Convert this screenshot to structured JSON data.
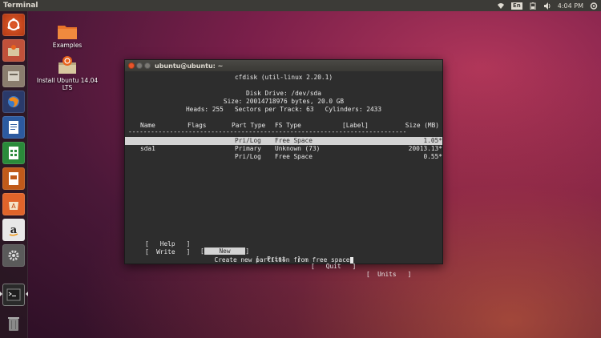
{
  "top_panel": {
    "title": "Terminal",
    "keyboard": "En",
    "time": "4:04 PM"
  },
  "desktop": {
    "icons": [
      {
        "label": "Examples"
      },
      {
        "label": "Install Ubuntu 14.04 LTS"
      }
    ]
  },
  "launcher": {
    "items": [
      "dash-home",
      "files-install",
      "file-manager",
      "firefox",
      "writer",
      "calc",
      "impress",
      "software-center",
      "amazon",
      "system-settings",
      "terminal",
      "trash"
    ]
  },
  "terminal": {
    "window_title": "ubuntu@ubuntu: ~",
    "header": {
      "app": "cfdisk (util-linux 2.20.1)",
      "drive": "Disk Drive: /dev/sda",
      "size": "Size: 20014718976 bytes, 20.0 GB",
      "geometry": "Heads: 255   Sectors per Track: 63   Cylinders: 2433"
    },
    "columns": [
      "Name",
      "Flags",
      "Part Type",
      "FS Type",
      "[Label]",
      "Size (MB)"
    ],
    "separator": "--------------------------------------------------------------------------",
    "rows": [
      {
        "name": "",
        "flags": "",
        "part_type": "Pri/Log",
        "fs_type": "Free Space",
        "label": "",
        "size": "1.05*",
        "selected": true
      },
      {
        "name": "sda1",
        "flags": "",
        "part_type": "Primary",
        "fs_type": "Unknown (73)",
        "label": "",
        "size": "20013.13*",
        "selected": false
      },
      {
        "name": "",
        "flags": "",
        "part_type": "Pri/Log",
        "fs_type": "Free Space",
        "label": "",
        "size": "0.55*",
        "selected": false
      }
    ],
    "menu": [
      "Help",
      "New",
      "Print",
      "Quit",
      "Units",
      "Write"
    ],
    "active_menu": "New",
    "status": "Create new partition from free space"
  }
}
